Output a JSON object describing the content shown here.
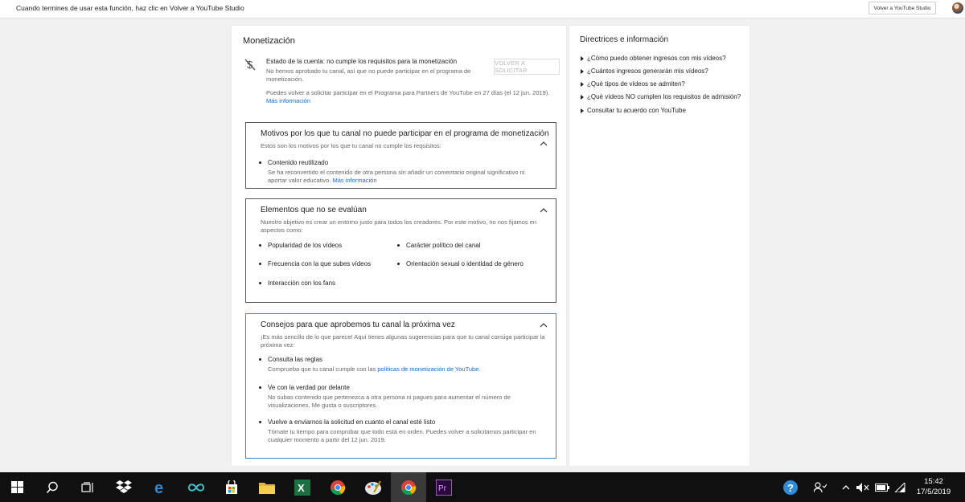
{
  "topbar": {
    "message": "Cuando termines de usar esta función, haz clic en Volver a YouTube Studio",
    "back_button": "Volver a YouTube Studio"
  },
  "monetization": {
    "title": "Monetización",
    "status_title": "Estado de la cuenta: no cumple los requisitos para la monetización",
    "status_desc": "No hemos aprobado tu canal, así que no puede participar en el programa de monetización.",
    "reapply_text": "Puedes volver a solicitar participar en el Programa para Partners de YouTube en 27 días (el 12 jun. 2019).",
    "more_info": "Más información",
    "reapply_button": "VOLVER A SOLICITAR"
  },
  "panels": {
    "reasons": {
      "title": "Motivos por los que tu canal no puede participar en el programa de monetización",
      "subtitle": "Estos son los motivos por los que tu canal no cumple los requisitos:",
      "item_title": "Contenido reutilizado",
      "item_desc": "Se ha reconvertido el contenido de otra persona sin añadir un comentario original significativo ni aportar valor educativo.",
      "item_link": "Más información"
    },
    "not_evaluated": {
      "title": "Elementos que no se evalúan",
      "subtitle": "Nuestro objetivo es crear un entorno justo para todos los creadores. Por este motivo, no nos fijamos en aspectos como:",
      "items": [
        "Popularidad de los vídeos",
        "Carácter político del canal",
        "Frecuencia con la que subes vídeos",
        "Orientación sexual o identidad de género",
        "Interacción con los fans"
      ]
    },
    "tips": {
      "title": "Consejos para que aprobemos tu canal la próxima vez",
      "subtitle": "¡Es más sencillo de lo que parece! Aquí tienes algunas sugerencias para que tu canal consiga participar la próxima vez:",
      "tip1_title": "Consulta las reglas",
      "tip1_desc_prefix": "Comprueba que tu canal cumple con las ",
      "tip1_link": "políticas de monetización de YouTube",
      "tip1_desc_suffix": ".",
      "tip2_title": "Ve con la verdad por delante",
      "tip2_desc": "No subas contenido que pertenezca a otra persona ni pagues para aumentar el número de visualizaciones, Me gusta o suscriptores.",
      "tip3_title": "Vuelve a enviarnos la solicitud en cuanto el canal esté listo",
      "tip3_desc": "Tómate tu tiempo para comprobar que todo está en orden. Puedes volver a solicitarnos participar en cualquier momento a partir del 12 jun. 2019."
    }
  },
  "sidebar": {
    "title": "Directrices e información",
    "links": [
      "¿Cómo puedo obtener ingresos con mis vídeos?",
      "¿Cuántos ingresos generarán mis vídeos?",
      "¿Qué tipos de vídeos se admiten?",
      "¿Qué vídeos NO cumplen los requisitos de admisión?",
      "Consultar tu acuerdo con YouTube"
    ]
  },
  "taskbar": {
    "time": "15:42",
    "date": "17/5/2019",
    "apps": [
      "windows-start-icon",
      "search-icon",
      "task-view-icon",
      "dropbox-icon",
      "edge-icon",
      "infinity-icon",
      "store-icon",
      "file-explorer-icon",
      "excel-icon",
      "chrome-icon",
      "paint-icon",
      "chrome-active-icon",
      "premiere-icon"
    ],
    "excel_letter": "X",
    "premiere_label": "Pr",
    "help_label": "?"
  }
}
